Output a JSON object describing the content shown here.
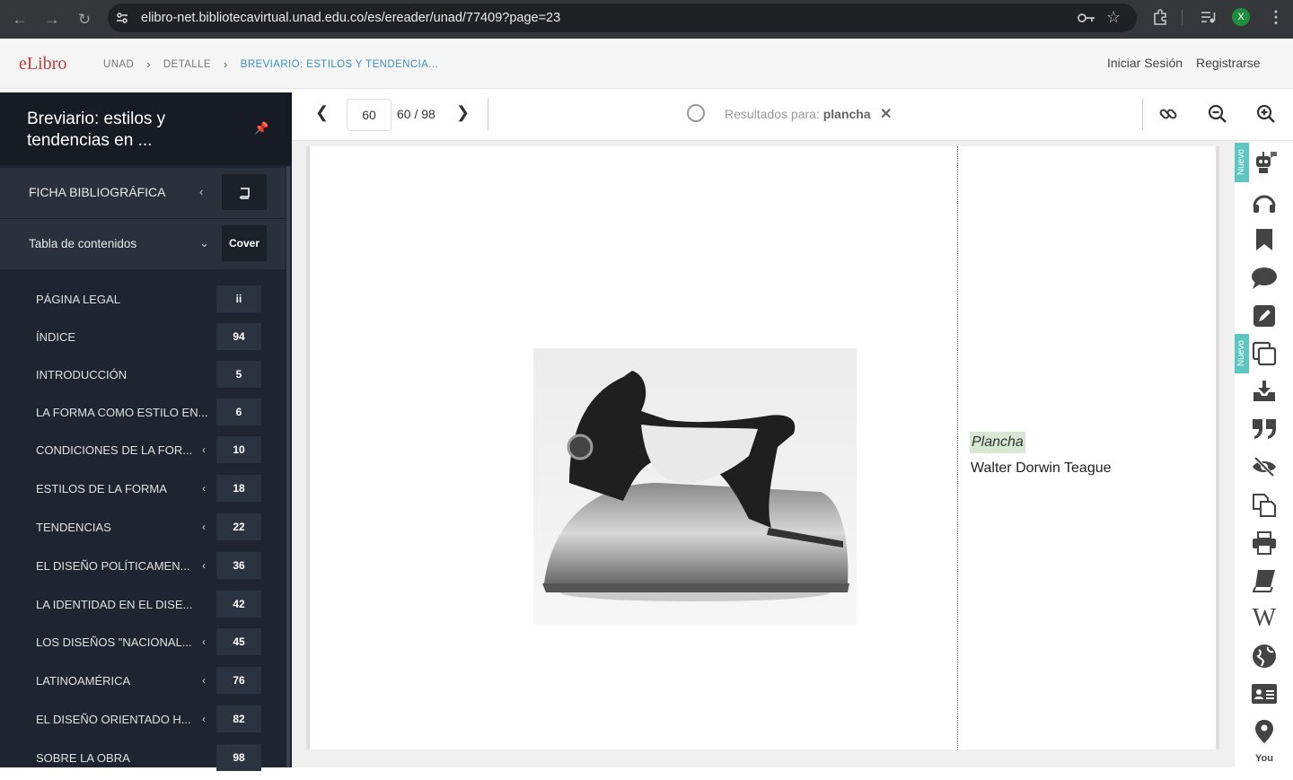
{
  "browser": {
    "url": "elibro-net.bibliotecavirtual.unad.edu.co/es/ereader/unad/77409?page=23",
    "profile_initial": "X"
  },
  "header": {
    "logo": {
      "e": "e",
      "libro": "Libro"
    },
    "breadcrumb": [
      "UNAD",
      "DETALLE",
      "BREVIARIO: ESTILOS Y TENDENCIA..."
    ],
    "login": "Iniciar Sesión",
    "register": "Registrarse"
  },
  "sidebar": {
    "book_title": "Breviario: estilos y tendencias en ...",
    "ficha": {
      "label": "FICHA BIBLIOGRÁFICA"
    },
    "toc": {
      "label": "Tabla de contenidos",
      "cover": "Cover"
    },
    "items": [
      {
        "label": "PÁGINA LEGAL",
        "page": "ii",
        "chevron": ""
      },
      {
        "label": "ÍNDICE",
        "page": "94",
        "chevron": ""
      },
      {
        "label": "INTRODUCCIÓN",
        "page": "5",
        "chevron": ""
      },
      {
        "label": "LA FORMA COMO ESTILO EN...",
        "page": "6",
        "chevron": ""
      },
      {
        "label": "CONDICIONES DE LA FOR...",
        "page": "10",
        "chevron": "‹"
      },
      {
        "label": "ESTILOS DE LA FORMA",
        "page": "18",
        "chevron": "‹"
      },
      {
        "label": "TENDENCIAS",
        "page": "22",
        "chevron": "‹"
      },
      {
        "label": "EL DISEÑO POLÍTICAMEN...",
        "page": "36",
        "chevron": "‹"
      },
      {
        "label": "LA IDENTIDAD EN EL DISE...",
        "page": "42",
        "chevron": ""
      },
      {
        "label": "LOS DISEÑOS \"NACIONAL...",
        "page": "45",
        "chevron": "‹"
      },
      {
        "label": "LATINOAMÉRICA",
        "page": "76",
        "chevron": "‹"
      },
      {
        "label": "EL DISEÑO ORIENTADO H...",
        "page": "82",
        "chevron": "‹"
      },
      {
        "label": "SOBRE LA OBRA",
        "page": "98",
        "chevron": ""
      }
    ]
  },
  "toolbar": {
    "page_input": "60",
    "page_count": "60 / 98",
    "search_prefix": "Resultados para:",
    "search_term": "plancha"
  },
  "document": {
    "caption_title": "Plancha",
    "caption_author": "Walter Dorwin Teague"
  },
  "rail": {
    "badge": "Nuevo"
  }
}
